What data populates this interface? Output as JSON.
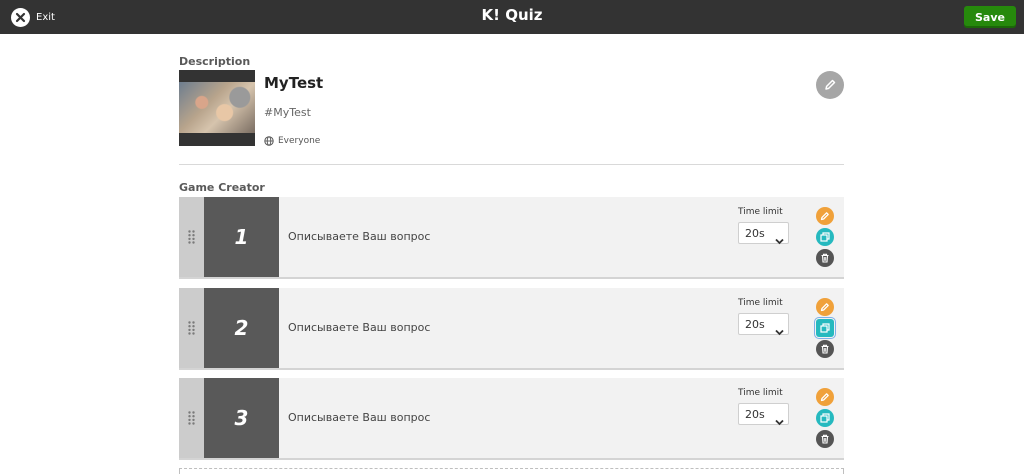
{
  "topbar": {
    "exit_label": "Exit",
    "logo_mark": "K!",
    "title": "Quiz",
    "save_label": "Save",
    "save_color": "#26890c"
  },
  "description": {
    "section_title": "Description",
    "quiz_name": "MyTest",
    "hashtag": "#MyTest",
    "visibility": "Everyone",
    "visibility_icon": "globe-icon",
    "edit_icon": "pencil-icon"
  },
  "game_creator": {
    "section_title": "Game Creator",
    "questions": [
      {
        "number": "1",
        "text": "Описываете Ваш вопрос",
        "time_limit_label": "Time limit",
        "time_limit_value": "20s"
      },
      {
        "number": "2",
        "text": "Описываете Ваш вопрос",
        "time_limit_label": "Time limit",
        "time_limit_value": "20s"
      },
      {
        "number": "3",
        "text": "Описываете Ваш вопрос",
        "time_limit_label": "Time limit",
        "time_limit_value": "20s"
      }
    ],
    "action_icons": [
      "pencil-icon",
      "duplicate-icon",
      "trash-icon"
    ],
    "colors": {
      "edit": "#f0a13a",
      "duplicate": "#26b9bf",
      "delete": "#555555",
      "number_block": "#595959"
    }
  }
}
